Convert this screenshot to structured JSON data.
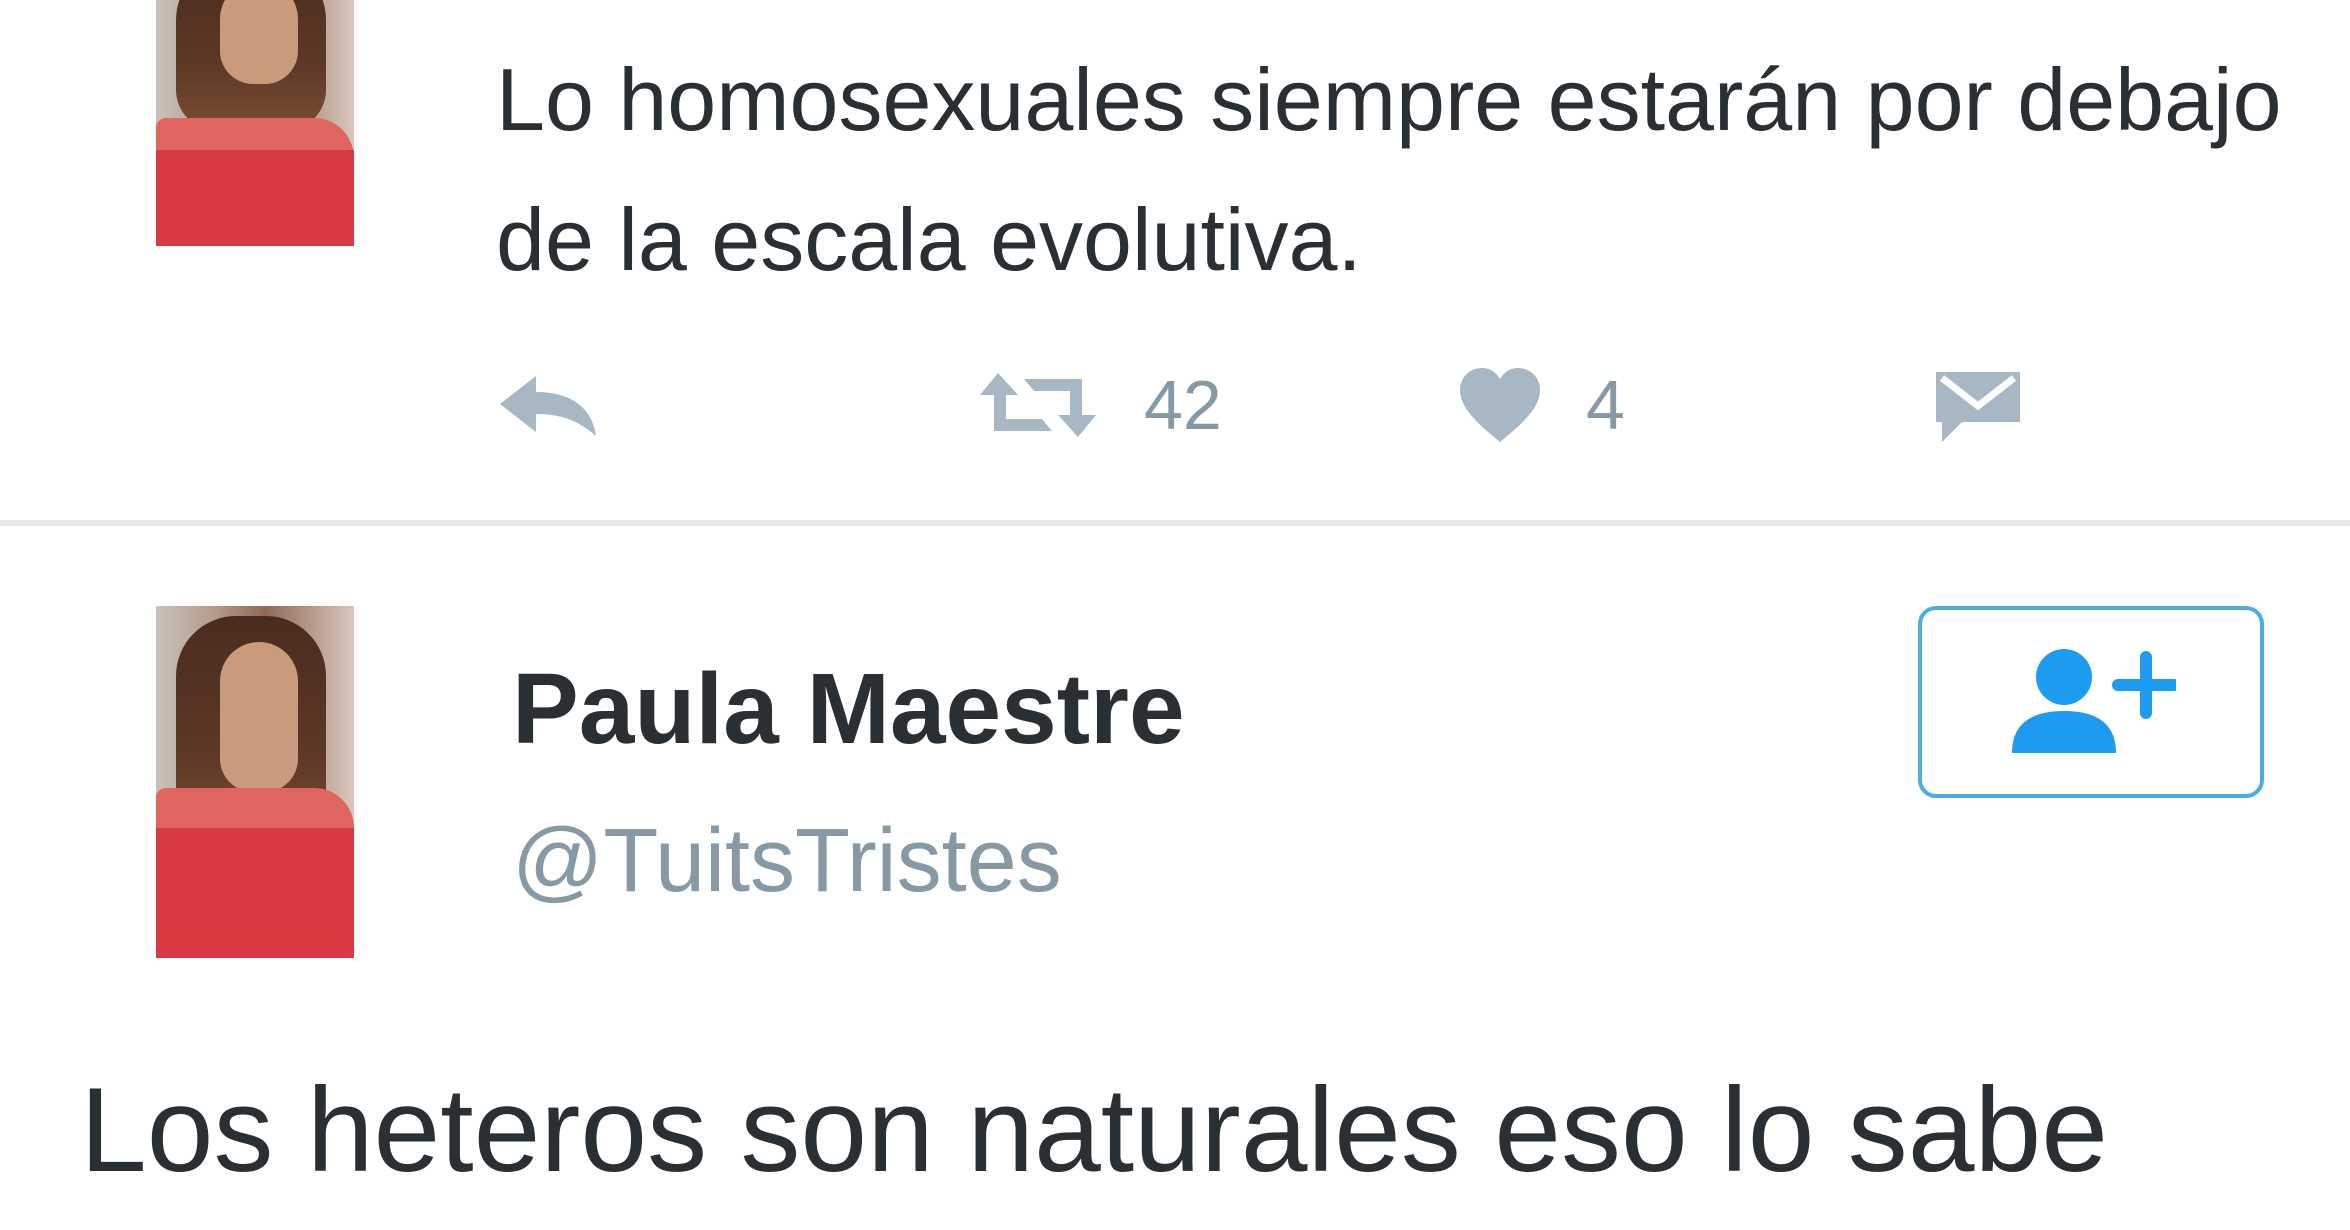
{
  "top_tweet": {
    "text": "Lo homosexuales siempre estarán por debajo de la escala evolutiva.",
    "actions": {
      "reply_icon": "reply-icon",
      "retweet_icon": "retweet-icon",
      "retweet_count": "42",
      "like_icon": "heart-icon",
      "like_count": "4",
      "dm_icon": "direct-message-icon"
    }
  },
  "bottom_tweet": {
    "display_name": "Paula Maestre",
    "handle": "@TuitsTristes",
    "follow_icon": "add-user-icon",
    "text": "Los heteros son naturales eso lo sabe"
  },
  "colors": {
    "text": "#292f33",
    "muted": "#8899a6",
    "accent": "#1da1f2",
    "divider": "#e6e9ec"
  }
}
